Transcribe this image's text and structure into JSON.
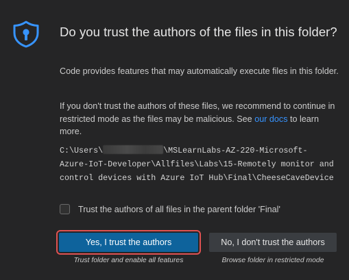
{
  "dialog": {
    "icon": "shield-lock-icon",
    "title": "Do you trust the authors of the files in this folder?",
    "paragraph1": "Code provides features that may automatically execute files in this folder.",
    "paragraph2_before_link": "If you don't trust the authors of these files, we recommend to continue in restricted mode as the files may be malicious. See ",
    "paragraph2_link": "our docs",
    "paragraph2_after_link": " to learn more.",
    "path_prefix": "C:\\Users\\",
    "path_line1_suffix": "\\MSLearnLabs-AZ-220-Microsoft-",
    "path_line2": "Azure-IoT-Developer\\Allfiles\\Labs\\15-Remotely monitor and",
    "path_line3": "control devices with Azure IoT Hub\\Final\\CheeseCaveDevice",
    "checkbox_label": "Trust the authors of all files in the parent folder 'Final'",
    "checkbox_checked": false,
    "primary_button": "Yes, I trust the authors",
    "primary_caption": "Trust folder and enable all features",
    "secondary_button": "No, I don't trust the authors",
    "secondary_caption": "Browse folder in restricted mode"
  },
  "colors": {
    "background": "#252526",
    "accent": "#3794ff",
    "primary_button": "#0e639c",
    "highlight_outline": "#e05252"
  }
}
